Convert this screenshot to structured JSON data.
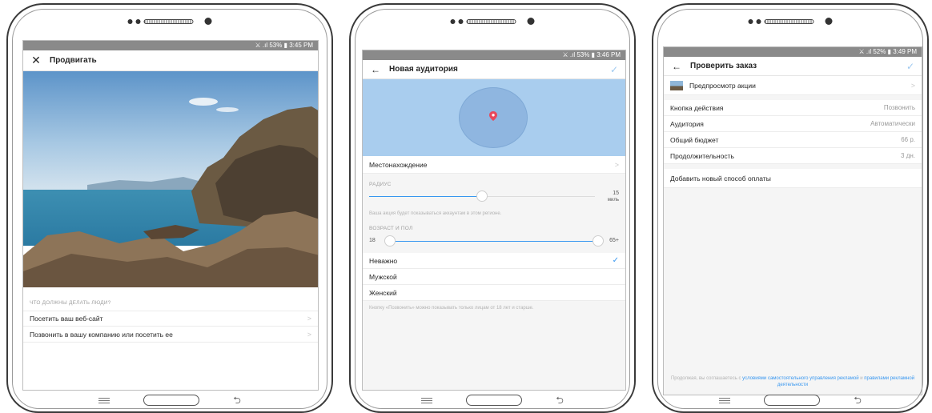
{
  "status": {
    "phone1": "⚔ .‌ıl 53% ▮ 3:45 PM",
    "phone2": "⚔ .ıl 53% ▮ 3:46 PM",
    "phone3": "⚔ .ıl 52% ▮ 3:49 PM"
  },
  "phone1": {
    "title": "Продвигать",
    "section": "ЧТО ДОЛЖНЫ ДЕЛАТЬ ЛЮДИ?",
    "options": [
      "Посетить ваш веб-сайт",
      "Позвонить в вашу компанию или посетить ее"
    ]
  },
  "phone2": {
    "title": "Новая аудитория",
    "location_label": "Местонахождение",
    "radius_header": "РАДИУС",
    "radius_value": "15",
    "radius_unit": "миль",
    "radius_hint": "Ваша акция будет показываться аккаунтам в этом регионе.",
    "age_header": "ВОЗРАСТ И ПОЛ",
    "age_min": "18",
    "age_max": "65+",
    "genders": [
      "Неважно",
      "Мужской",
      "Женский"
    ],
    "gender_hint": "Кнопку «Позвонить» можно показывать только лицам от 18 лет и старше.",
    "radius_fraction": 0.5,
    "age_range_fraction": [
      0.0,
      1.0
    ]
  },
  "phone3": {
    "title": "Проверить заказ",
    "preview_label": "Предпросмотр акции",
    "rows": [
      {
        "label": "Кнопка действия",
        "value": "Позвонить"
      },
      {
        "label": "Аудитория",
        "value": "Автоматически"
      },
      {
        "label": "Общий бюджет",
        "value": "66 р."
      },
      {
        "label": "Продолжительность",
        "value": "3 дн."
      }
    ],
    "add_payment": "Добавить новый способ оплаты",
    "footer_prefix": "Продолжая, вы соглашаетесь с ",
    "footer_link1": "условиями самостоятельного управления рекламой",
    "footer_mid": " и ",
    "footer_link2": "правилами рекламной деятельности"
  },
  "colors": {
    "accent": "#3897f0",
    "map": "#a9cdee",
    "pin": "#e8485b"
  }
}
